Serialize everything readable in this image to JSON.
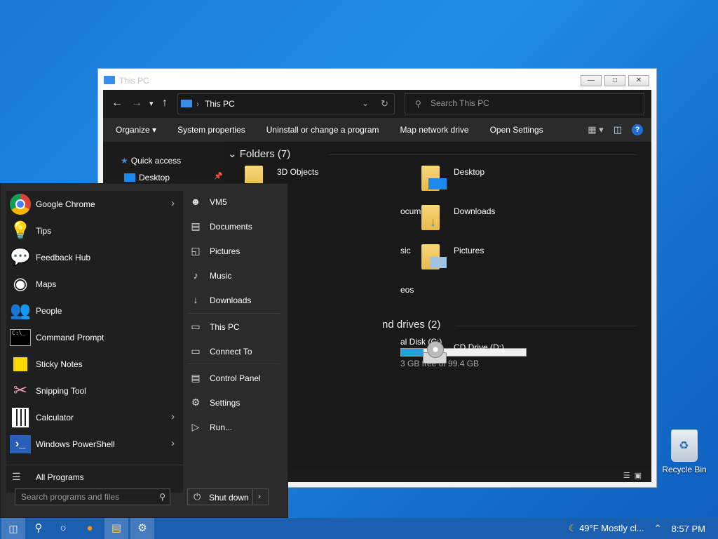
{
  "explorer": {
    "title": "This PC",
    "address": "This PC",
    "search_placeholder": "Search This PC",
    "commands": [
      "Organize ▾",
      "System properties",
      "Uninstall or change a program",
      "Map network drive",
      "Open Settings"
    ],
    "help_label": "?",
    "nav": {
      "quick_access": "Quick access",
      "desktop": "Desktop"
    },
    "folders_header": "Folders (7)",
    "folders": [
      {
        "label": "3D Objects"
      },
      {
        "label": "Desktop"
      },
      {
        "label": "ocuments"
      },
      {
        "label": "Downloads"
      },
      {
        "label": "sic"
      },
      {
        "label": "Pictures"
      },
      {
        "label": "eos"
      }
    ],
    "drives_header": "nd drives (2)",
    "drives": [
      {
        "label": "al Disk (C:)",
        "info": "3 GB free of 99.4 GB",
        "used_fraction": 0.18
      },
      {
        "label": "CD Drive (D:)"
      }
    ]
  },
  "start_menu": {
    "programs": [
      {
        "label": "Google Chrome",
        "icon": "chrome-icon",
        "has_arrow": true
      },
      {
        "label": "Tips",
        "icon": "lightbulb-icon",
        "has_arrow": false
      },
      {
        "label": "Feedback Hub",
        "icon": "feedback-icon",
        "has_arrow": false
      },
      {
        "label": "Maps",
        "icon": "maps-icon",
        "has_arrow": false
      },
      {
        "label": "People",
        "icon": "people-icon",
        "has_arrow": false
      },
      {
        "label": "Command Prompt",
        "icon": "cmd-icon",
        "has_arrow": false
      },
      {
        "label": "Sticky Notes",
        "icon": "sticky-notes-icon",
        "has_arrow": false
      },
      {
        "label": "Snipping Tool",
        "icon": "snipping-tool-icon",
        "has_arrow": false
      },
      {
        "label": "Calculator",
        "icon": "calculator-icon",
        "has_arrow": true
      },
      {
        "label": "Windows PowerShell",
        "icon": "powershell-icon",
        "has_arrow": true
      }
    ],
    "all_programs": "All Programs",
    "search_placeholder": "Search programs and files",
    "places": [
      {
        "label": "VM5",
        "icon": "user-icon"
      },
      {
        "label": "Documents",
        "icon": "document-icon"
      },
      {
        "label": "Pictures",
        "icon": "picture-icon"
      },
      {
        "label": "Music",
        "icon": "music-icon"
      },
      {
        "label": "Downloads",
        "icon": "download-icon"
      },
      {
        "label": "This PC",
        "icon": "computer-icon"
      },
      {
        "label": "Connect To",
        "icon": "connect-icon"
      },
      {
        "label": "Control Panel",
        "icon": "control-panel-icon"
      },
      {
        "label": "Settings",
        "icon": "gear-icon"
      },
      {
        "label": "Run...",
        "icon": "run-icon"
      }
    ],
    "shutdown": "Shut down"
  },
  "taskbar": {
    "weather": "49°F  Mostly cl...",
    "time": "8:57 PM"
  },
  "desktop": {
    "recycle_bin": "Recycle Bin"
  }
}
